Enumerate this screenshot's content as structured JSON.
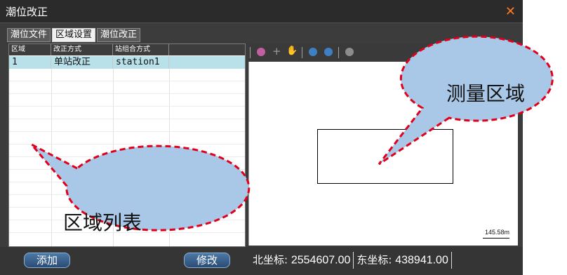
{
  "window": {
    "title": "潮位改正",
    "close_icon": "close-icon"
  },
  "tabs": [
    {
      "label": "潮位文件",
      "active": false
    },
    {
      "label": "区域设置",
      "active": true
    },
    {
      "label": "潮位改正",
      "active": false
    }
  ],
  "table": {
    "headers": [
      "区域",
      "改正方式",
      "站组合方式"
    ],
    "rows": [
      [
        "1",
        "单站改正",
        "station1"
      ]
    ]
  },
  "toolbar": {
    "icons": [
      "draw-icon",
      "crosshair-icon",
      "pan-hand-icon",
      "zoom-in-icon",
      "zoom-out-icon",
      "full-extent-icon"
    ]
  },
  "map": {
    "scale_label": "145.58m"
  },
  "buttons": {
    "add": "添加",
    "modify": "修改"
  },
  "coords": {
    "north_label": "北坐标:",
    "north_value": "2554607.00",
    "east_label": "东坐标:",
    "east_value": "438941.00"
  },
  "annotations": {
    "measure_area": "测量区域",
    "area_list": "区域列表"
  },
  "colors": {
    "title_bg": "#2b2b2b",
    "accent_close": "#ff7a1a",
    "row_selected": "#b9e1ea",
    "button_blue": "#3a6590",
    "bubble_fill": "#a9c7e6",
    "bubble_dash": "#e0001b"
  }
}
